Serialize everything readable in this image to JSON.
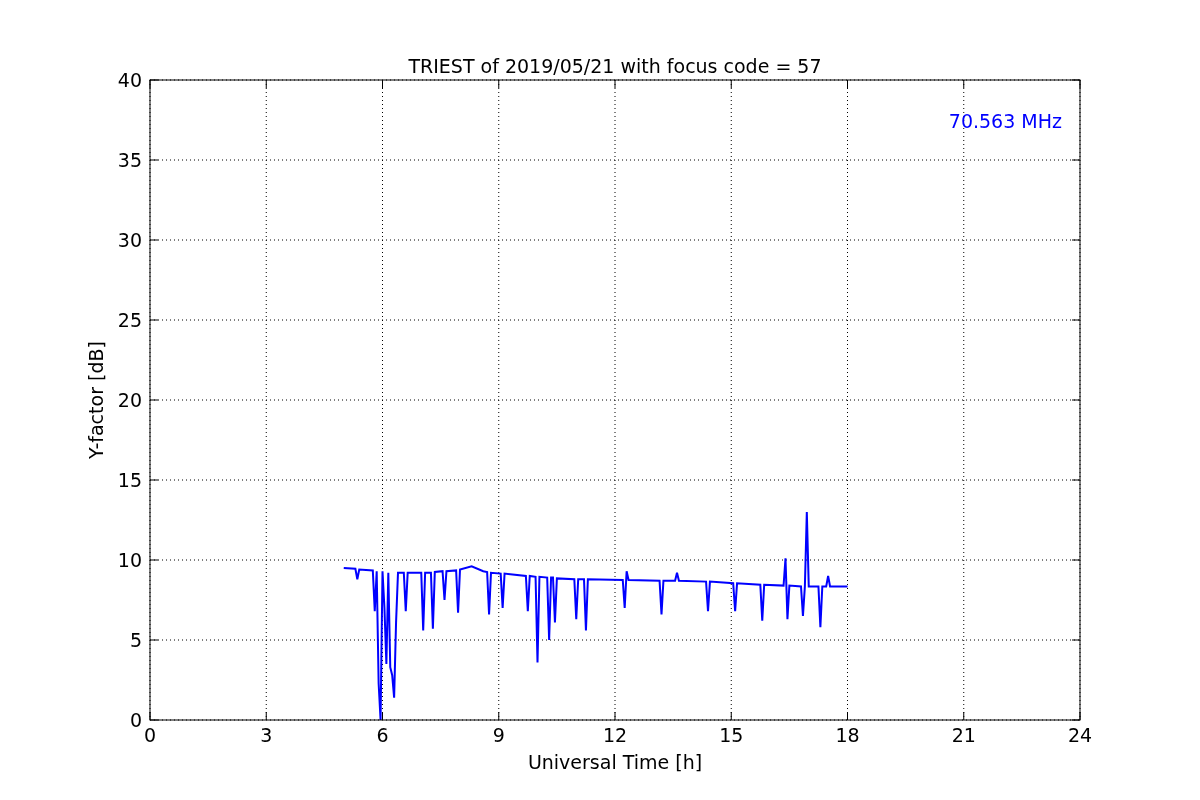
{
  "figure": {
    "chart_data": {
      "type": "line",
      "title": "TRIEST of 2019/05/21 with focus code = 57",
      "xlabel": "Universal Time [h]",
      "ylabel": "Y-factor [dB]",
      "xlim": [
        0,
        24
      ],
      "ylim": [
        0,
        40
      ],
      "xticks": [
        0,
        3,
        6,
        9,
        12,
        15,
        18,
        21,
        24
      ],
      "yticks": [
        0,
        5,
        10,
        15,
        20,
        25,
        30,
        35,
        40
      ],
      "x": [
        5.0,
        5.3,
        5.35,
        5.4,
        5.75,
        5.8,
        5.85,
        5.9,
        5.95,
        6.0,
        6.05,
        6.1,
        6.15,
        6.2,
        6.25,
        6.3,
        6.35,
        6.4,
        6.55,
        6.6,
        6.65,
        7.0,
        7.05,
        7.1,
        7.25,
        7.3,
        7.35,
        7.55,
        7.6,
        7.65,
        7.9,
        7.95,
        8.0,
        8.3,
        8.6,
        8.7,
        8.75,
        8.8,
        9.05,
        9.1,
        9.15,
        9.7,
        9.75,
        9.8,
        9.95,
        10.0,
        10.05,
        10.25,
        10.3,
        10.35,
        10.4,
        10.45,
        10.5,
        10.95,
        11.0,
        11.05,
        11.2,
        11.25,
        11.3,
        12.2,
        12.25,
        12.3,
        12.35,
        13.15,
        13.2,
        13.25,
        13.55,
        13.6,
        13.65,
        14.35,
        14.4,
        14.45,
        15.05,
        15.1,
        15.15,
        15.75,
        15.8,
        15.85,
        16.35,
        16.4,
        16.45,
        16.5,
        16.8,
        16.85,
        16.9,
        16.95,
        17.0,
        17.25,
        17.3,
        17.35,
        17.45,
        17.5,
        17.55,
        18.0
      ],
      "series": [
        {
          "name": "70.563 MHz",
          "color": "#0000ff",
          "values": [
            9.5,
            9.45,
            8.8,
            9.4,
            9.35,
            6.8,
            9.3,
            2.3,
            0,
            9.3,
            7.0,
            3.5,
            9.2,
            3.3,
            2.8,
            1.4,
            6.1,
            9.2,
            9.2,
            6.8,
            9.2,
            9.2,
            5.6,
            9.2,
            9.2,
            5.7,
            9.25,
            9.3,
            7.5,
            9.3,
            9.35,
            6.7,
            9.4,
            9.6,
            9.3,
            9.25,
            6.6,
            9.2,
            9.15,
            7.0,
            9.15,
            9.0,
            6.8,
            9.0,
            8.95,
            3.6,
            8.95,
            8.9,
            5.0,
            8.9,
            8.9,
            6.1,
            8.85,
            8.8,
            6.3,
            8.8,
            8.8,
            5.6,
            8.8,
            8.75,
            7.0,
            9.3,
            8.75,
            8.7,
            6.6,
            8.7,
            8.7,
            9.2,
            8.7,
            8.65,
            6.8,
            8.65,
            8.55,
            6.8,
            8.55,
            8.45,
            6.2,
            8.45,
            8.4,
            10.1,
            6.3,
            8.4,
            8.35,
            6.5,
            8.35,
            13.0,
            8.35,
            8.35,
            5.8,
            8.35,
            8.35,
            9.0,
            8.35,
            8.35
          ]
        }
      ],
      "grid": true
    }
  }
}
